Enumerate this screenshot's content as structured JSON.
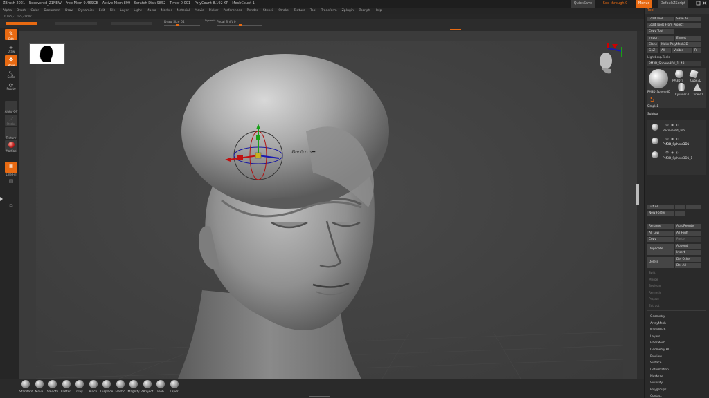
{
  "titlebar": {
    "app": "ZBrush 2021",
    "document": "Recovered_21NEW",
    "stats": [
      "Free Mem 9.469GB",
      "Active Mem 899",
      "Scratch Disk 9852",
      "Timer 0.001",
      "PolyCount 8.192 KP",
      "MeshCount 1"
    ],
    "quicksave": "QuickSave",
    "seethrough": "See-through 0",
    "menus_label": "Menus",
    "defaultscript": "DefaultZScript"
  },
  "menubar": [
    "Alpha",
    "Brush",
    "Color",
    "Document",
    "Draw",
    "Dynamics",
    "Edit",
    "File",
    "Layer",
    "Light",
    "Macro",
    "Marker",
    "Material",
    "Movie",
    "Picker",
    "Preferences",
    "Render",
    "Stencil",
    "Stroke",
    "Texture",
    "Tool",
    "Transform",
    "Zplugin",
    "Zscript",
    "Help"
  ],
  "infobar": "0.085,-1.055,-0.607",
  "topshelf": {
    "draw_size": "Draw Size 64",
    "dynamic": "Dynamic",
    "focal_shift": "Focal Shift 0"
  },
  "lefttray": {
    "edit": "Edit",
    "draw": "Draw",
    "move": "Move",
    "scale": "Scale",
    "rotate": "Rotate",
    "alpha": "Alpha Off",
    "stroke": "Stroke",
    "texture": "Texture",
    "material": "MatCap",
    "lineFill": "Line Fill"
  },
  "brushes": [
    "Standard",
    "Move",
    "Smooth",
    "Flatten",
    "Clay",
    "Pinch",
    "Displace",
    "Elastic",
    "Magnify",
    "ZProject",
    "Blob",
    "Layer"
  ],
  "rightpanel": {
    "title": "Tool",
    "buttons": {
      "load_tool": "Load Tool",
      "save_as": "Save As",
      "load_from_project": "Load Tools From Project",
      "copy_tool": "Copy Tool",
      "import": "Import",
      "export": "Export",
      "clone": "Clone",
      "make_polymesh": "Make PolyMesh3D",
      "goz": "GoZ",
      "all": "All",
      "visible": "Visible",
      "r": "R"
    },
    "lightbox_tools": "Lightbox▶Tools",
    "current_tool": "PM3D_Sphere3D1_1. 48",
    "tool_thumbs": [
      "PM3D_Sphere3D",
      "PM3D_S",
      "Cube3D",
      "Cylinder3D",
      "Cone3D",
      "SimpleB"
    ],
    "subtool_header": "Subtool",
    "subtools": [
      "Recovered_Tool",
      "PM3D_Sphere3D1",
      "PM3D_Sphere3D1_1"
    ],
    "list_all": "List All",
    "new_folder": "New Folder",
    "rename": "Rename",
    "autoreorder": "AutoReorder",
    "all_low": "All Low",
    "all_high": "All High",
    "copy": "Copy",
    "paste": "Paste",
    "duplicate": "Duplicate",
    "append": "Append",
    "insert": "Insert",
    "delete": "Delete",
    "del_other": "Del Other",
    "del_all": "Del All",
    "disabled_items": [
      "Split",
      "Merge",
      "Boolean",
      "Remesh",
      "Project",
      "Extract"
    ],
    "menu_items": [
      "Geometry",
      "ArrayMesh",
      "NanoMesh",
      "Layers",
      "FiberMesh",
      "Geometry HD",
      "Preview",
      "Surface",
      "Deformation",
      "Masking",
      "Visibility",
      "Polygroups",
      "Contact"
    ]
  },
  "colors": {
    "accent": "#e86a12",
    "panel": "#2a2a2a",
    "canvas": "#3b3b3b"
  },
  "icons": [
    "edit-icon",
    "draw-icon",
    "move-icon",
    "scale-icon",
    "rotate-icon",
    "gizmo-icon",
    "head-navigator-icon"
  ]
}
